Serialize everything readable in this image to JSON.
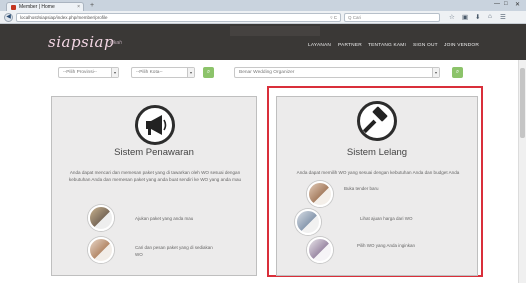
{
  "browser": {
    "tab_title": "Member | Home",
    "tab_close": "×",
    "new_tab": "+",
    "url": "localhost/siapsiap/index.php/member/profile",
    "url_icons": "▿ C",
    "search_placeholder": "Q Cari",
    "window_controls": [
      "—",
      "□",
      "✕"
    ]
  },
  "site": {
    "logo": "siapsiap",
    "logo_sub": "nikah",
    "menu": [
      "LAYANAN",
      "PARTNER",
      "TENTANG KAMI",
      "SIGN OUT",
      "JOIN VENDOR"
    ]
  },
  "search": {
    "province": "--Pilih Provinsi--",
    "city": "--Pilih Kota--",
    "category": "Benar Wedding Organizer"
  },
  "cards": {
    "left": {
      "title": "Sistem Penawaran",
      "desc": "Anda dapat mencari dan memesan paket yang di tawarkan oleh WO sesuai dengan kebutuhan Anda dan memesan paket yang anda buat sendiri ke WO yang anda mau",
      "features": [
        "Ajukan paket yang anda mau",
        "Cari dan pesan paket yang di sediakan WO"
      ]
    },
    "right": {
      "title": "Sistem Lelang",
      "desc": "Anda dapat memilih WO yang sesuai dengan kebutuhan Anda dan budget Anda",
      "features": [
        "Buka tender baru",
        "Lihat ajuan harga dari WO",
        "Pilih WO yang Anda inginkan"
      ]
    }
  },
  "colors": {
    "header": "#3a3836",
    "logo": "#f3d6e4",
    "button_green": "#8cc36a",
    "highlight_red": "#d92f3a",
    "card_bg": "#ecebeb"
  },
  "icons": {
    "left_card": "megaphone-icon",
    "right_card": "gavel-icon"
  }
}
